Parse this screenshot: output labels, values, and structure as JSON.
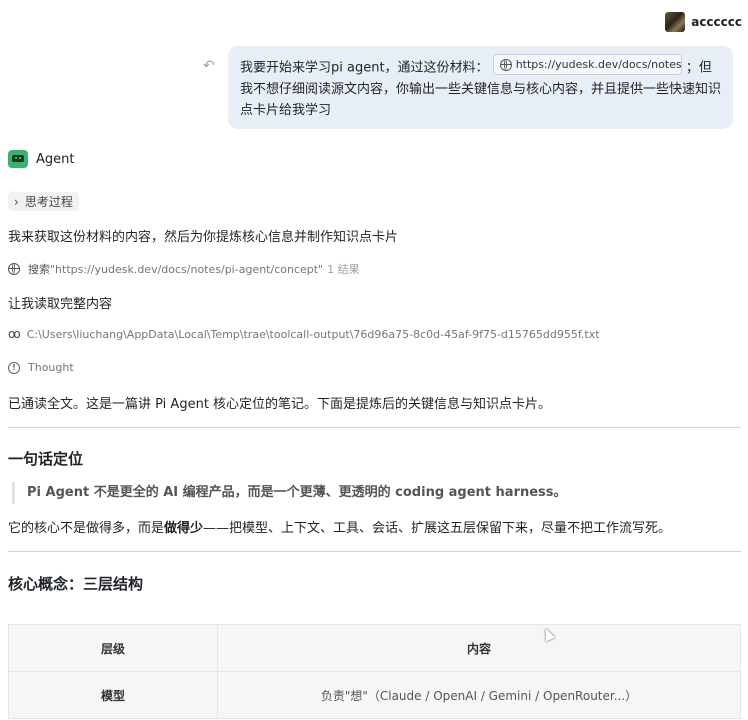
{
  "user": {
    "name": "acccccc"
  },
  "message": {
    "text_before": "我要开始来学习pi agent，通过这份材料：",
    "link": "https://yudesk.dev/docs/notes...",
    "text_after": "；但我不想仔细阅读源文内容，你输出一些关键信息与核心内容，并且提供一些快速知识点卡片给我学习"
  },
  "agent": {
    "name": "Agent",
    "thinking_label": "思考过程",
    "intro": "我来获取这份材料的内容，然后为你提炼核心信息并制作知识点卡片",
    "search_label": "搜索",
    "search_query": "\"https://yudesk.dev/docs/notes/pi-agent/concept\"",
    "search_count": "1 结果",
    "read_intro": "让我读取完整内容",
    "file_path": "C:\\Users\\liuchang\\AppData\\Local\\Temp\\trae\\toolcall-output\\76d96a75-8c0d-45af-9f75-d15765dd955f.txt",
    "thought_label": "Thought",
    "summary": "已通读全文。这是一篇讲 Pi Agent 核心定位的笔记。下面是提炼后的关键信息与知识点卡片。"
  },
  "section1": {
    "title": "一句话定位",
    "quote": "Pi Agent 不是更全的 AI 编程产品，而是一个更薄、更透明的 coding agent harness。",
    "body_before": "它的核心不是做得多，而是",
    "body_bold": "做得少",
    "body_after": "——把模型、上下文、工具、会话、扩展这五层保留下来，尽量不把工作流写死。"
  },
  "section2": {
    "title": "核心概念：三层结构",
    "table": {
      "headers": [
        "层级",
        "内容"
      ],
      "rows": [
        [
          "模型",
          "负责\"想\"（Claude / OpenAI / Gemini / OpenRouter...）"
        ]
      ]
    }
  }
}
